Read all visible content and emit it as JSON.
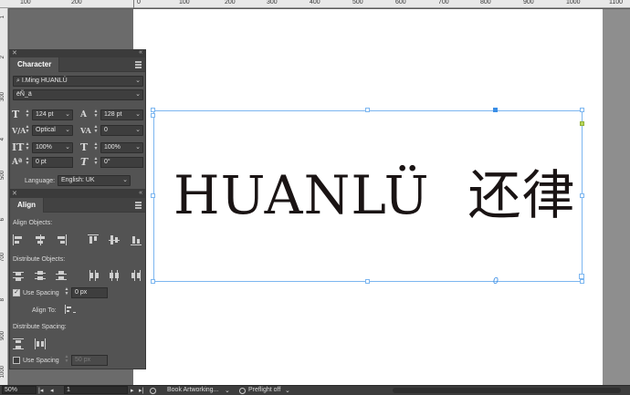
{
  "ruler": {
    "top_numbers": [
      "100",
      "200",
      "0",
      "100",
      "200",
      "300",
      "400",
      "500",
      "600",
      "700",
      "800",
      "900",
      "1000",
      "1100"
    ],
    "left_numbers": [
      "1",
      "2",
      "300",
      "4",
      "500",
      "6",
      "700",
      "8",
      "900",
      "1000"
    ]
  },
  "character_panel": {
    "tab_label": "Character",
    "font_family": "I.Ming HUANLÜ",
    "font_style": "ëÑ_ä",
    "font_size": "124 pt",
    "leading": "128 pt",
    "kerning": "Optical",
    "tracking": "0",
    "vertical_scale": "100%",
    "horizontal_scale": "100%",
    "baseline_shift": "0 pt",
    "skew": "0°",
    "language_label": "Language:",
    "language": "English: UK"
  },
  "align_panel": {
    "tab_label": "Align",
    "align_objects_label": "Align Objects:",
    "distribute_objects_label": "Distribute Objects:",
    "use_spacing_label": "Use Spacing",
    "use_spacing_value": "0 px",
    "use_spacing_checked": true,
    "align_to_label": "Align To:",
    "distribute_spacing_label": "Distribute Spacing:",
    "use_spacing2_label": "Use Spacing",
    "use_spacing2_value": "50 px",
    "use_spacing2_checked": false
  },
  "artwork": {
    "latin_text": "HUANLÜ",
    "cjk_text": "还律",
    "text_color": "#1a1414",
    "frame_color": "#7cb6f0"
  },
  "status_bar": {
    "zoom": "50%",
    "page": "1",
    "document": "Book Artworking...",
    "preflight": "Preflight off"
  }
}
